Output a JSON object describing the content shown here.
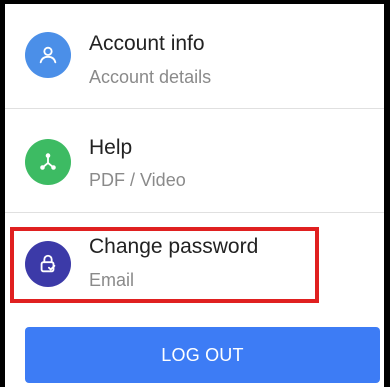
{
  "menu": {
    "items": [
      {
        "title": "Account info",
        "subtitle": "Account details",
        "icon": "user-icon",
        "color": "#4b8fe8"
      },
      {
        "title": "Help",
        "subtitle": "PDF / Video",
        "icon": "share-nodes-icon",
        "color": "#3dbb63"
      },
      {
        "title": "Change password",
        "subtitle": "Email",
        "icon": "lock-check-icon",
        "color": "#3c3aa8"
      }
    ]
  },
  "actions": {
    "logout_label": "LOG OUT"
  },
  "colors": {
    "highlight": "#e02020",
    "logout_button": "#3d7cf5"
  }
}
